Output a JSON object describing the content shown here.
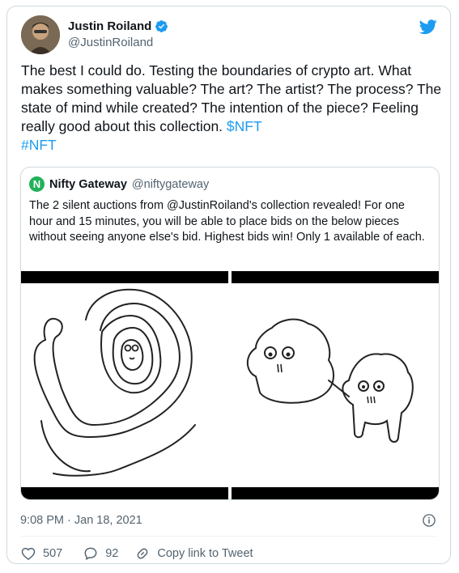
{
  "author": {
    "name": "Justin Roiland",
    "handle": "@JustinRoiland"
  },
  "tweet": {
    "text_main": "The best I could do. Testing the boundaries of crypto art. What makes something valuable? The art? The artist? The process? The state of mind while created? The intention of the piece? Feeling really good about this collection. ",
    "hashtag_1": "$NFT",
    "hashtag_2": "#NFT"
  },
  "quote": {
    "logo_letter": "N",
    "name": "Nifty Gateway",
    "handle": "@niftygateway",
    "text": "The 2 silent auctions from @JustinRoiland's collection revealed! For one hour and 15 minutes, you will be able to place bids on the below pieces without seeing anyone else's bid. Highest bids win! Only 1 available of each."
  },
  "meta": {
    "timestamp": "9:08 PM · Jan 18, 2021"
  },
  "actions": {
    "likes": "507",
    "replies": "92",
    "copy_link": "Copy link to Tweet"
  },
  "colors": {
    "link": "#1d9bf0",
    "verified": "#1d9bf0",
    "twitter_brand": "#1d9bf0",
    "nifty_brand": "#21b15a"
  }
}
